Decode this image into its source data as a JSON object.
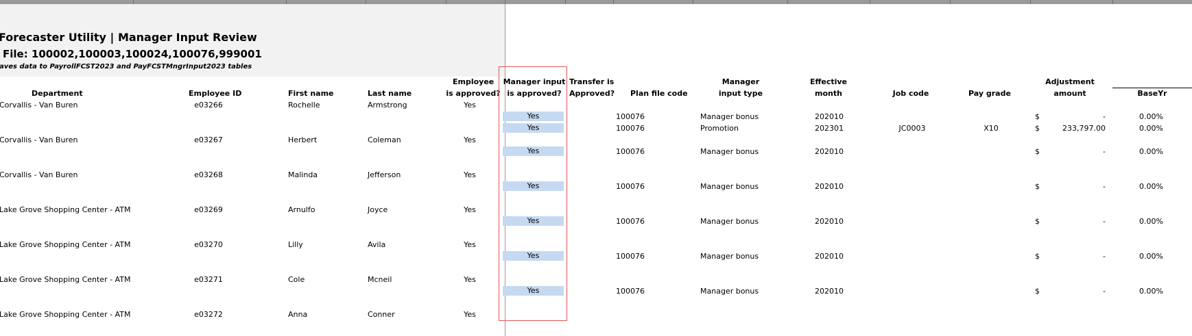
{
  "header": {
    "title": "Forecaster Utility | Manager Input Review",
    "file_line": "File: 100002,100003,100024,100076,999001",
    "note": "aves data to PayrollFCST2023 and PayFCSTMngrInput2023 tables"
  },
  "columns": {
    "department": "Department",
    "employee_id": "Employee ID",
    "first_name": "First name",
    "last_name": "Last name",
    "employee_approved_1": "Employee",
    "employee_approved_2": "is approved?",
    "manager_input_1": "Manager input",
    "manager_input_2": "is approved?",
    "transfer_1": "Transfer is",
    "transfer_2": "Approved?",
    "plan_file": "Plan file code",
    "input_type_1": "Manager",
    "input_type_2": "input type",
    "effective_1": "Effective",
    "effective_2": "month",
    "job_code": "Job code",
    "pay_grade": "Pay grade",
    "adjustment_1": "Adjustment",
    "adjustment_2": "amount",
    "base_yr": "BaseYr"
  },
  "rows": [
    {
      "department": "Corvallis - Van Buren",
      "employee_id": "e03266",
      "first_name": "Rochelle",
      "last_name": "Armstrong",
      "employee_approved": "Yes",
      "inputs": [
        {
          "manager_approved": "Yes",
          "plan_file": "100076",
          "input_type": "Manager bonus",
          "effective": "202010",
          "job_code": "",
          "pay_grade": "",
          "currency": "$",
          "amount": "-",
          "base_yr": "0.00%"
        },
        {
          "manager_approved": "Yes",
          "plan_file": "100076",
          "input_type": "Promotion",
          "effective": "202301",
          "job_code": "JC0003",
          "pay_grade": "X10",
          "currency": "$",
          "amount": "233,797.00",
          "base_yr": "0.00%"
        }
      ]
    },
    {
      "department": "Corvallis - Van Buren",
      "employee_id": "e03267",
      "first_name": "Herbert",
      "last_name": "Coleman",
      "employee_approved": "Yes",
      "inputs": [
        {
          "manager_approved": "Yes",
          "plan_file": "100076",
          "input_type": "Manager bonus",
          "effective": "202010",
          "job_code": "",
          "pay_grade": "",
          "currency": "$",
          "amount": "-",
          "base_yr": "0.00%"
        }
      ]
    },
    {
      "department": "Corvallis - Van Buren",
      "employee_id": "e03268",
      "first_name": "Malinda",
      "last_name": "Jefferson",
      "employee_approved": "Yes",
      "inputs": [
        {
          "manager_approved": "Yes",
          "plan_file": "100076",
          "input_type": "Manager bonus",
          "effective": "202010",
          "job_code": "",
          "pay_grade": "",
          "currency": "$",
          "amount": "-",
          "base_yr": "0.00%"
        }
      ]
    },
    {
      "department": "Lake Grove Shopping Center - ATM",
      "employee_id": "e03269",
      "first_name": "Arnulfo",
      "last_name": "Joyce",
      "employee_approved": "Yes",
      "inputs": [
        {
          "manager_approved": "Yes",
          "plan_file": "100076",
          "input_type": "Manager bonus",
          "effective": "202010",
          "job_code": "",
          "pay_grade": "",
          "currency": "$",
          "amount": "-",
          "base_yr": "0.00%"
        }
      ]
    },
    {
      "department": "Lake Grove Shopping Center - ATM",
      "employee_id": "e03270",
      "first_name": "Lilly",
      "last_name": "Avila",
      "employee_approved": "Yes",
      "inputs": [
        {
          "manager_approved": "Yes",
          "plan_file": "100076",
          "input_type": "Manager bonus",
          "effective": "202010",
          "job_code": "",
          "pay_grade": "",
          "currency": "$",
          "amount": "-",
          "base_yr": "0.00%"
        }
      ]
    },
    {
      "department": "Lake Grove Shopping Center - ATM",
      "employee_id": "e03271",
      "first_name": "Cole",
      "last_name": "Mcneil",
      "employee_approved": "Yes",
      "inputs": [
        {
          "manager_approved": "Yes",
          "plan_file": "100076",
          "input_type": "Manager bonus",
          "effective": "202010",
          "job_code": "",
          "pay_grade": "",
          "currency": "$",
          "amount": "-",
          "base_yr": "0.00%"
        }
      ]
    },
    {
      "department": "Lake Grove Shopping Center - ATM",
      "employee_id": "e03272",
      "first_name": "Anna",
      "last_name": "Conner",
      "employee_approved": "Yes",
      "inputs": []
    }
  ],
  "colors": {
    "header_band": "#f2f2f2",
    "approved_cell": "#c5d9f1",
    "highlight_border": "#e05555"
  }
}
